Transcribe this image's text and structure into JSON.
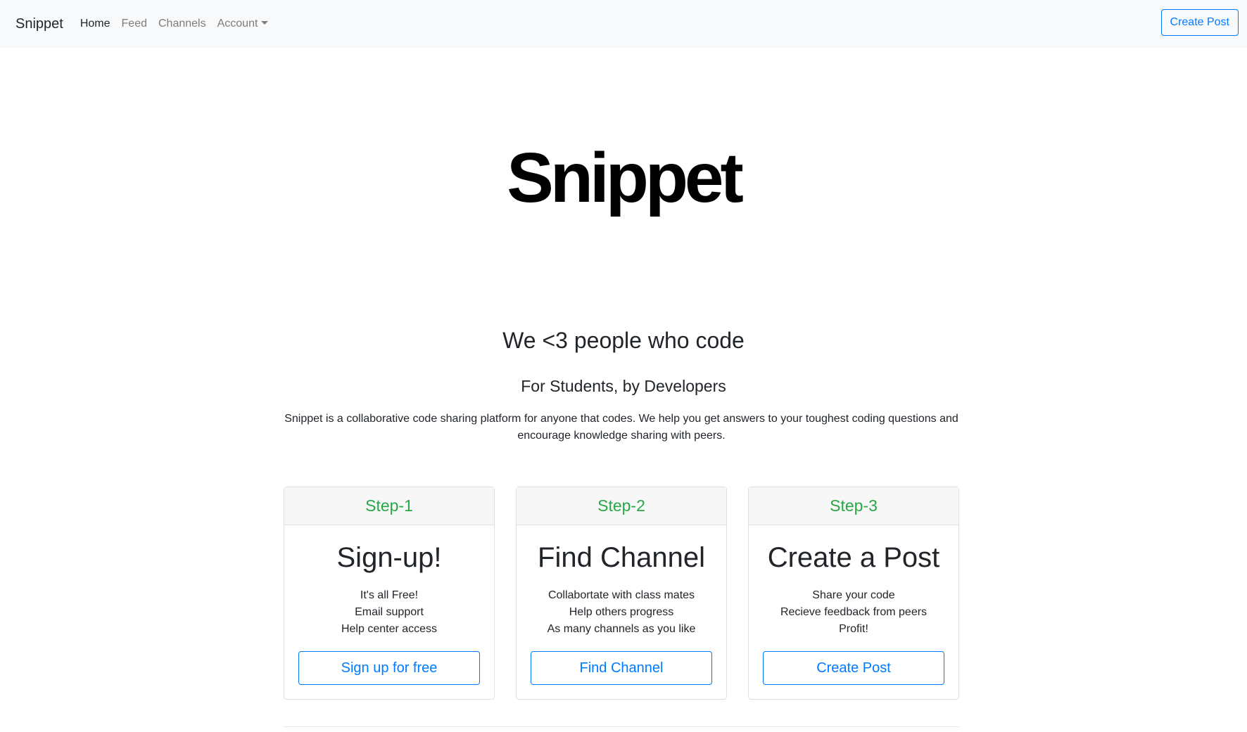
{
  "navbar": {
    "brand": "Snippet",
    "links": [
      {
        "label": "Home"
      },
      {
        "label": "Feed"
      },
      {
        "label": "Channels"
      },
      {
        "label": "Account"
      }
    ],
    "create_button": "Create Post"
  },
  "hero": {
    "logo_text": "Snippet",
    "tagline": "We <3 people who code",
    "subtagline": "For Students, by Developers",
    "description": "Snippet is a collaborative code sharing platform for anyone that codes. We help you get answers to your toughest coding questions and encourage knowledge sharing with peers."
  },
  "cards": [
    {
      "header": "Step-1",
      "title": "Sign-up!",
      "features": [
        "It's all Free!",
        "Email support",
        "Help center access"
      ],
      "button": "Sign up for free"
    },
    {
      "header": "Step-2",
      "title": "Find Channel",
      "features": [
        "Collabortate with class mates",
        "Help others progress",
        "As many channels as you like"
      ],
      "button": "Find Channel"
    },
    {
      "header": "Step-3",
      "title": "Create a Post",
      "features": [
        "Share your code",
        "Recieve feedback from peers",
        "Profit!"
      ],
      "button": "Create Post"
    }
  ],
  "colors": {
    "primary": "#007bff",
    "success": "#28a745",
    "navbar_bg": "#f8f9fa",
    "text": "#212529"
  }
}
